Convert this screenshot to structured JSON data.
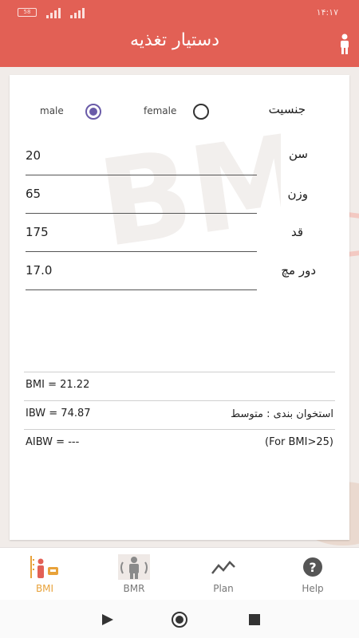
{
  "status": {
    "battery": "58",
    "time": "۱۴:۱۷"
  },
  "app": {
    "title": "دستیار تغذیه"
  },
  "form": {
    "gender_label": "جنسیت",
    "male_label": "male",
    "female_label": "female",
    "selected_gender": "male",
    "age_label": "سن",
    "age_value": "20",
    "weight_label": "وزن",
    "weight_value": "65",
    "height_label": "قد",
    "height_value": "175",
    "wrist_label": "دور مچ",
    "wrist_value": "17.0"
  },
  "results": {
    "bmi": "BMI = 21.22",
    "ibw": "IBW  = 74.87",
    "frame": "استخوان بندی : متوسط",
    "aibw": "AIBW = ---",
    "aibw_note": "(For BMI>25)"
  },
  "tabs": [
    {
      "label": "BMI",
      "icon": "bmi-chart-icon",
      "active": true
    },
    {
      "label": "BMR",
      "icon": "body-icon",
      "active": false
    },
    {
      "label": "Plan",
      "icon": "trend-icon",
      "active": false
    },
    {
      "label": "Help",
      "icon": "help-icon",
      "active": false
    }
  ],
  "colors": {
    "appbar": "#e26055",
    "radio_selected": "#6a5ba8",
    "active_tab": "#e8a23a"
  }
}
